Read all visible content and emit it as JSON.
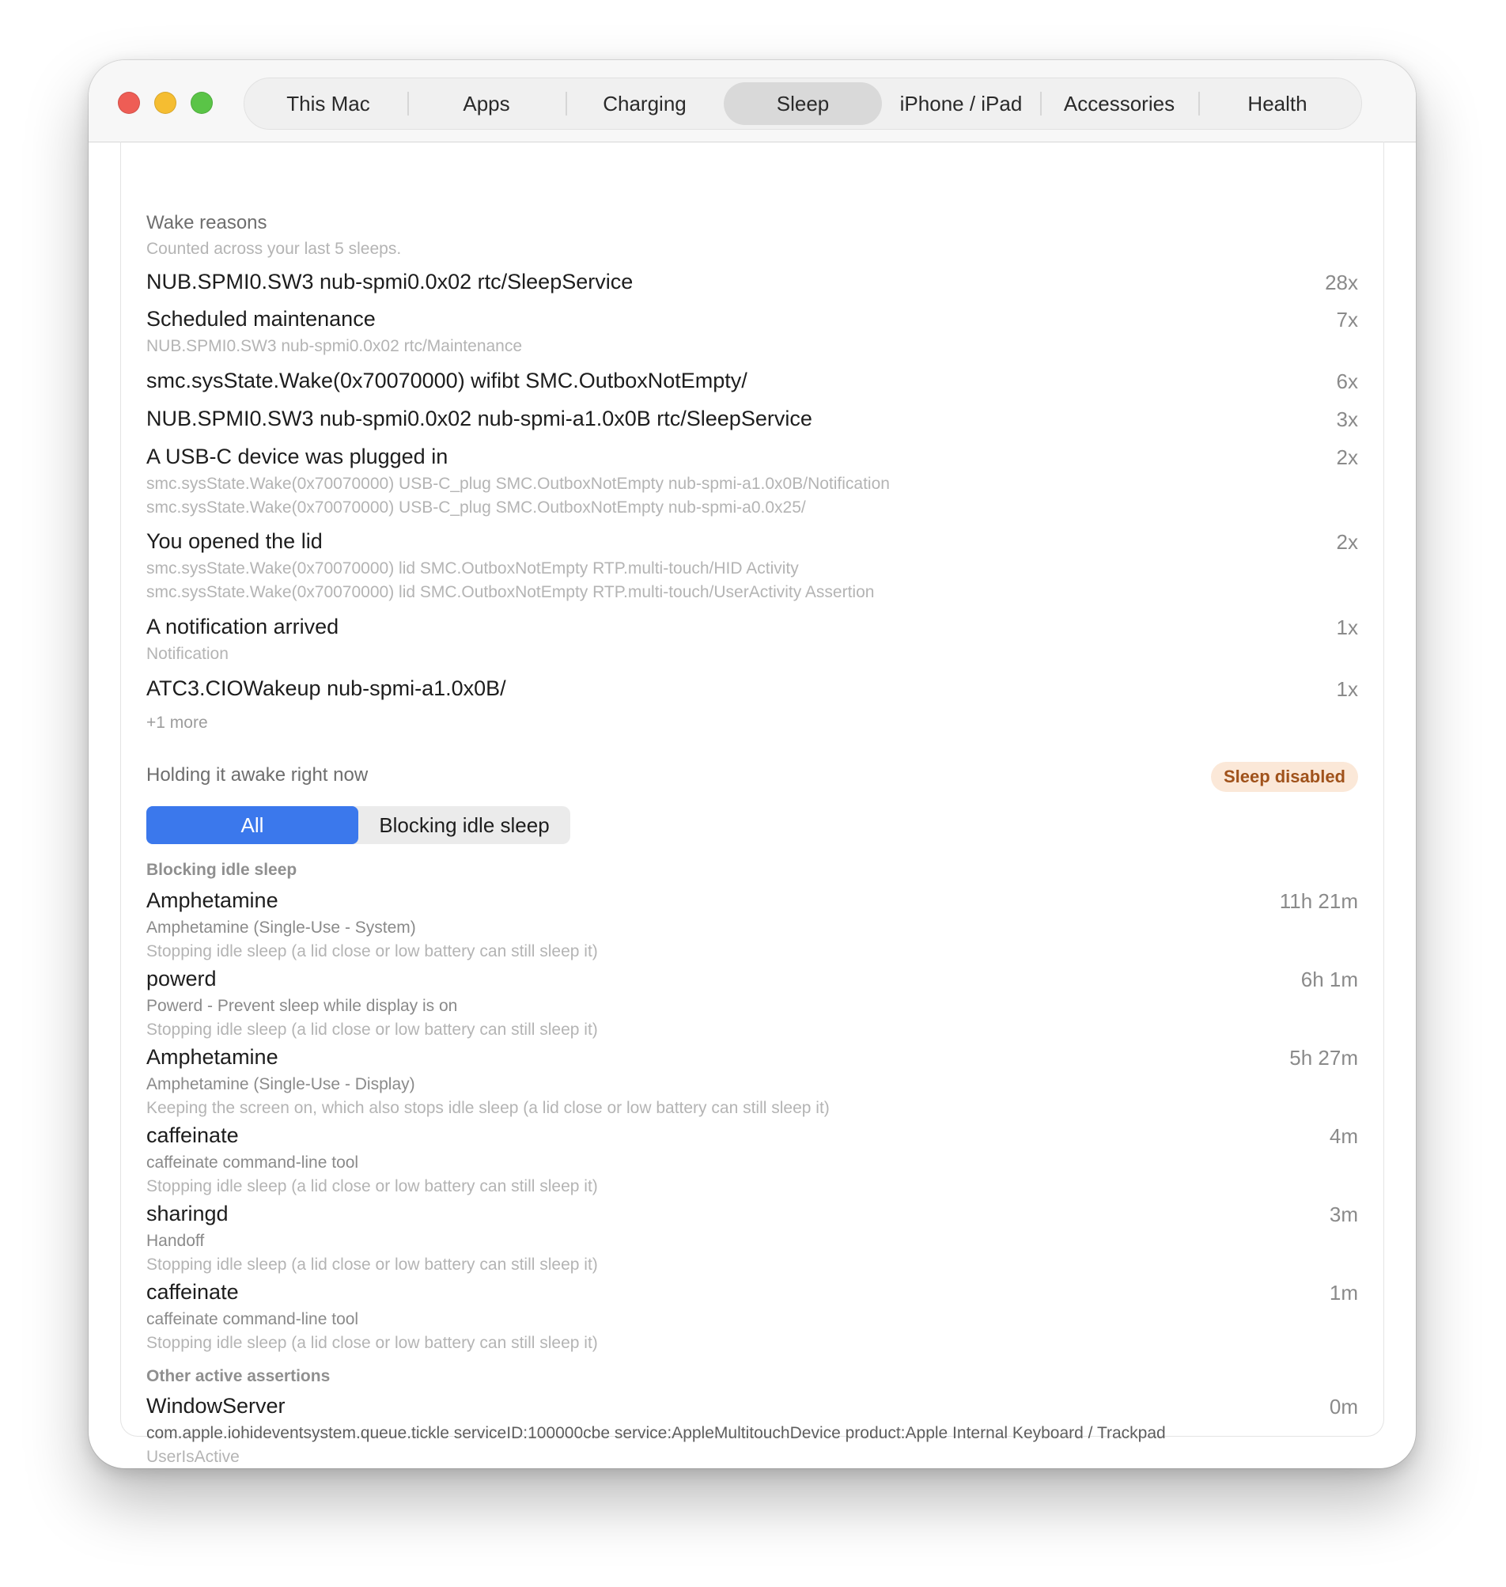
{
  "tabs": [
    {
      "label": "This Mac"
    },
    {
      "label": "Apps"
    },
    {
      "label": "Charging"
    },
    {
      "label": "Sleep"
    },
    {
      "label": "iPhone / iPad"
    },
    {
      "label": "Accessories"
    },
    {
      "label": "Health"
    }
  ],
  "wake": {
    "title": "Wake reasons",
    "subtitle": "Counted across your last 5 sleeps.",
    "rows": [
      {
        "title": "NUB.SPMI0.SW3 nub-spmi0.0x02 rtc/SleepService",
        "count": "28x"
      },
      {
        "title": "Scheduled maintenance",
        "count": "7x",
        "details": [
          "NUB.SPMI0.SW3 nub-spmi0.0x02 rtc/Maintenance"
        ]
      },
      {
        "title": "smc.sysState.Wake(0x70070000) wifibt SMC.OutboxNotEmpty/",
        "count": "6x"
      },
      {
        "title": "NUB.SPMI0.SW3 nub-spmi0.0x02 nub-spmi-a1.0x0B rtc/SleepService",
        "count": "3x"
      },
      {
        "title": "A USB-C device was plugged in",
        "count": "2x",
        "details": [
          "smc.sysState.Wake(0x70070000) USB-C_plug SMC.OutboxNotEmpty nub-spmi-a1.0x0B/Notification",
          "smc.sysState.Wake(0x70070000) USB-C_plug SMC.OutboxNotEmpty nub-spmi-a0.0x25/"
        ]
      },
      {
        "title": "You opened the lid",
        "count": "2x",
        "details": [
          "smc.sysState.Wake(0x70070000) lid SMC.OutboxNotEmpty RTP.multi-touch/HID Activity",
          "smc.sysState.Wake(0x70070000) lid SMC.OutboxNotEmpty RTP.multi-touch/UserActivity Assertion"
        ]
      },
      {
        "title": "A notification arrived",
        "count": "1x",
        "details": [
          "Notification"
        ]
      },
      {
        "title": "ATC3.CIOWakeup nub-spmi-a1.0x0B/",
        "count": "1x"
      }
    ],
    "more": "+1 more"
  },
  "awake": {
    "title": "Holding it awake right now",
    "badge": "Sleep disabled",
    "filter": {
      "all": "All",
      "blocking": "Blocking idle sleep"
    },
    "groups": [
      {
        "label": "Blocking idle sleep",
        "items": [
          {
            "name": "Amphetamine",
            "duration": "11h 21m",
            "sub": "Amphetamine (Single-Use - System)",
            "note": "Stopping idle sleep (a lid close or low battery can still sleep it)"
          },
          {
            "name": "powerd",
            "duration": "6h 1m",
            "sub": "Powerd - Prevent sleep while display is on",
            "note": "Stopping idle sleep (a lid close or low battery can still sleep it)"
          },
          {
            "name": "Amphetamine",
            "duration": "5h 27m",
            "sub": "Amphetamine (Single-Use - Display)",
            "note": "Keeping the screen on, which also stops idle sleep (a lid close or low battery can still sleep it)"
          },
          {
            "name": "caffeinate",
            "duration": "4m",
            "sub": "caffeinate command-line tool",
            "note": "Stopping idle sleep (a lid close or low battery can still sleep it)"
          },
          {
            "name": "sharingd",
            "duration": "3m",
            "sub": "Handoff",
            "note": "Stopping idle sleep (a lid close or low battery can still sleep it)"
          },
          {
            "name": "caffeinate",
            "duration": "1m",
            "sub": "caffeinate command-line tool",
            "note": "Stopping idle sleep (a lid close or low battery can still sleep it)"
          }
        ]
      },
      {
        "label": "Other active assertions",
        "items": [
          {
            "name": "WindowServer",
            "duration": "0m",
            "sub": "com.apple.iohideventsystem.queue.tickle serviceID:100000cbe service:AppleMultitouchDevice product:Apple Internal Keyboard / Trackpad",
            "note": "UserIsActive"
          }
        ]
      }
    ]
  }
}
